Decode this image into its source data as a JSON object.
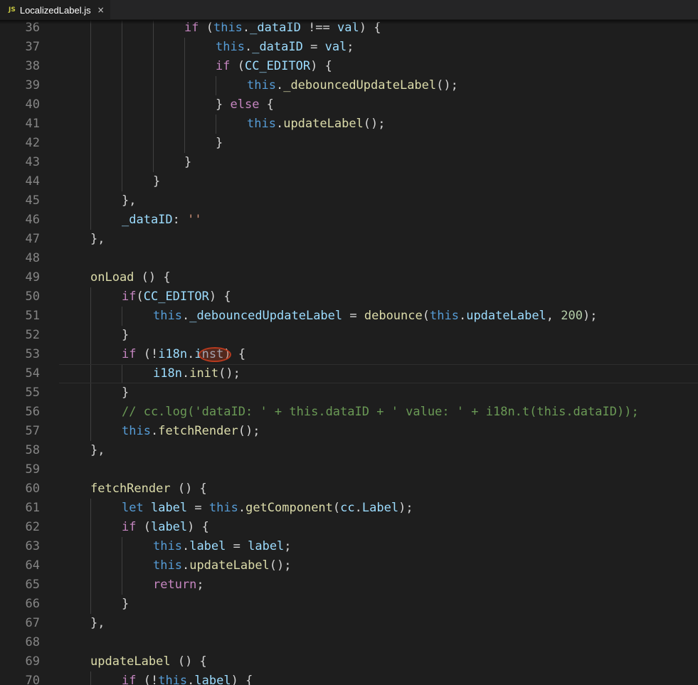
{
  "tab": {
    "icon_text": "JS",
    "filename": "LocalizedLabel.js",
    "close_glyph": "×",
    "icon": "javascript-file-icon"
  },
  "colors": {
    "background": "#1e1e1e",
    "keyword": "#c586c0",
    "this": "#569cd6",
    "variable": "#9cdcfe",
    "function": "#dcdcaa",
    "number": "#b5cea8",
    "string": "#ce9178",
    "comment": "#6a9955",
    "line_number": "#858585"
  },
  "current_line": 54,
  "highlighted_token": "inst",
  "lines": [
    {
      "n": "36",
      "indent": 4,
      "tokens": [
        [
          "kw",
          "if"
        ],
        [
          "op",
          " ("
        ],
        [
          "th",
          "this"
        ],
        [
          "op",
          "."
        ],
        [
          "var",
          "_dataID"
        ],
        [
          "op",
          " !== "
        ],
        [
          "var",
          "val"
        ],
        [
          "op",
          ") {"
        ]
      ]
    },
    {
      "n": "37",
      "indent": 5,
      "tokens": [
        [
          "th",
          "this"
        ],
        [
          "op",
          "."
        ],
        [
          "var",
          "_dataID"
        ],
        [
          "op",
          " = "
        ],
        [
          "var",
          "val"
        ],
        [
          "op",
          ";"
        ]
      ]
    },
    {
      "n": "38",
      "indent": 5,
      "tokens": [
        [
          "kw",
          "if"
        ],
        [
          "op",
          " ("
        ],
        [
          "var",
          "CC_EDITOR"
        ],
        [
          "op",
          ") {"
        ]
      ]
    },
    {
      "n": "39",
      "indent": 6,
      "tokens": [
        [
          "th",
          "this"
        ],
        [
          "op",
          "."
        ],
        [
          "fn",
          "_debouncedUpdateLabel"
        ],
        [
          "op",
          "();"
        ]
      ]
    },
    {
      "n": "40",
      "indent": 5,
      "tokens": [
        [
          "op",
          "} "
        ],
        [
          "kw",
          "else"
        ],
        [
          "op",
          " {"
        ]
      ]
    },
    {
      "n": "41",
      "indent": 6,
      "tokens": [
        [
          "th",
          "this"
        ],
        [
          "op",
          "."
        ],
        [
          "fn",
          "updateLabel"
        ],
        [
          "op",
          "();"
        ]
      ]
    },
    {
      "n": "42",
      "indent": 5,
      "tokens": [
        [
          "op",
          "}"
        ]
      ]
    },
    {
      "n": "43",
      "indent": 4,
      "tokens": [
        [
          "op",
          "}"
        ]
      ]
    },
    {
      "n": "44",
      "indent": 3,
      "tokens": [
        [
          "op",
          "}"
        ]
      ]
    },
    {
      "n": "45",
      "indent": 2,
      "tokens": [
        [
          "op",
          "},"
        ]
      ]
    },
    {
      "n": "46",
      "indent": 2,
      "tokens": [
        [
          "var",
          "_dataID"
        ],
        [
          "op",
          ": "
        ],
        [
          "str",
          "''"
        ]
      ]
    },
    {
      "n": "47",
      "indent": 1,
      "tokens": [
        [
          "op",
          "},"
        ]
      ]
    },
    {
      "n": "48",
      "indent": 0,
      "tokens": []
    },
    {
      "n": "49",
      "indent": 1,
      "tokens": [
        [
          "fn",
          "onLoad"
        ],
        [
          "op",
          " () {"
        ]
      ]
    },
    {
      "n": "50",
      "indent": 2,
      "tokens": [
        [
          "kw",
          "if"
        ],
        [
          "op",
          "("
        ],
        [
          "var",
          "CC_EDITOR"
        ],
        [
          "op",
          ") {"
        ]
      ]
    },
    {
      "n": "51",
      "indent": 3,
      "tokens": [
        [
          "th",
          "this"
        ],
        [
          "op",
          "."
        ],
        [
          "var",
          "_debouncedUpdateLabel"
        ],
        [
          "op",
          " = "
        ],
        [
          "fn",
          "debounce"
        ],
        [
          "op",
          "("
        ],
        [
          "th",
          "this"
        ],
        [
          "op",
          "."
        ],
        [
          "var",
          "updateLabel"
        ],
        [
          "op",
          ", "
        ],
        [
          "num",
          "200"
        ],
        [
          "op",
          ");"
        ]
      ]
    },
    {
      "n": "52",
      "indent": 2,
      "tokens": [
        [
          "op",
          "}"
        ]
      ]
    },
    {
      "n": "53",
      "indent": 2,
      "tokens": [
        [
          "kw",
          "if"
        ],
        [
          "op",
          " (!"
        ],
        [
          "var",
          "i18n"
        ],
        [
          "op",
          "."
        ],
        [
          "var",
          "inst"
        ],
        [
          "op",
          ") {"
        ]
      ],
      "highlight": true
    },
    {
      "n": "54",
      "indent": 3,
      "tokens": [
        [
          "var",
          "i18n"
        ],
        [
          "op",
          "."
        ],
        [
          "fn",
          "init"
        ],
        [
          "op",
          "();"
        ]
      ],
      "current": true
    },
    {
      "n": "55",
      "indent": 2,
      "tokens": [
        [
          "op",
          "}"
        ]
      ]
    },
    {
      "n": "56",
      "indent": 2,
      "tokens": [
        [
          "cm",
          "// cc.log('dataID: ' + this.dataID + ' value: ' + i18n.t(this.dataID));"
        ]
      ]
    },
    {
      "n": "57",
      "indent": 2,
      "tokens": [
        [
          "th",
          "this"
        ],
        [
          "op",
          "."
        ],
        [
          "fn",
          "fetchRender"
        ],
        [
          "op",
          "();"
        ]
      ]
    },
    {
      "n": "58",
      "indent": 1,
      "tokens": [
        [
          "op",
          "},"
        ]
      ]
    },
    {
      "n": "59",
      "indent": 0,
      "tokens": []
    },
    {
      "n": "60",
      "indent": 1,
      "tokens": [
        [
          "fn",
          "fetchRender"
        ],
        [
          "op",
          " () {"
        ]
      ]
    },
    {
      "n": "61",
      "indent": 2,
      "tokens": [
        [
          "sb",
          "let"
        ],
        [
          "op",
          " "
        ],
        [
          "var",
          "label"
        ],
        [
          "op",
          " = "
        ],
        [
          "th",
          "this"
        ],
        [
          "op",
          "."
        ],
        [
          "fn",
          "getComponent"
        ],
        [
          "op",
          "("
        ],
        [
          "var",
          "cc"
        ],
        [
          "op",
          "."
        ],
        [
          "var",
          "Label"
        ],
        [
          "op",
          ");"
        ]
      ]
    },
    {
      "n": "62",
      "indent": 2,
      "tokens": [
        [
          "kw",
          "if"
        ],
        [
          "op",
          " ("
        ],
        [
          "var",
          "label"
        ],
        [
          "op",
          ") {"
        ]
      ]
    },
    {
      "n": "63",
      "indent": 3,
      "tokens": [
        [
          "th",
          "this"
        ],
        [
          "op",
          "."
        ],
        [
          "var",
          "label"
        ],
        [
          "op",
          " = "
        ],
        [
          "var",
          "label"
        ],
        [
          "op",
          ";"
        ]
      ]
    },
    {
      "n": "64",
      "indent": 3,
      "tokens": [
        [
          "th",
          "this"
        ],
        [
          "op",
          "."
        ],
        [
          "fn",
          "updateLabel"
        ],
        [
          "op",
          "();"
        ]
      ]
    },
    {
      "n": "65",
      "indent": 3,
      "tokens": [
        [
          "kw",
          "return"
        ],
        [
          "op",
          ";"
        ]
      ]
    },
    {
      "n": "66",
      "indent": 2,
      "tokens": [
        [
          "op",
          "}"
        ]
      ]
    },
    {
      "n": "67",
      "indent": 1,
      "tokens": [
        [
          "op",
          "},"
        ]
      ]
    },
    {
      "n": "68",
      "indent": 0,
      "tokens": []
    },
    {
      "n": "69",
      "indent": 1,
      "tokens": [
        [
          "fn",
          "updateLabel"
        ],
        [
          "op",
          " () {"
        ]
      ]
    },
    {
      "n": "70",
      "indent": 2,
      "tokens": [
        [
          "kw",
          "if"
        ],
        [
          "op",
          " (!"
        ],
        [
          "th",
          "this"
        ],
        [
          "op",
          "."
        ],
        [
          "var",
          "label"
        ],
        [
          "op",
          ") {"
        ]
      ]
    }
  ]
}
